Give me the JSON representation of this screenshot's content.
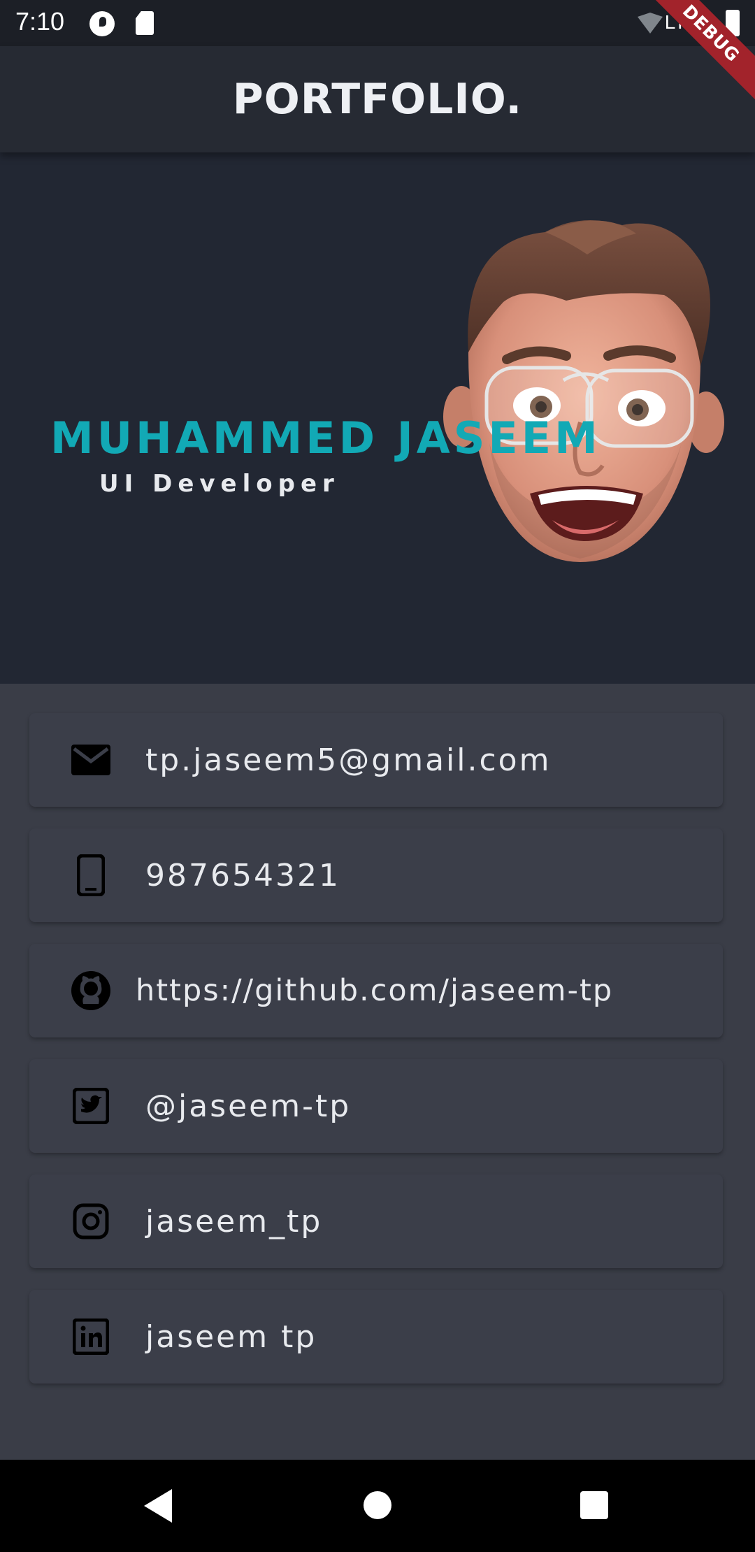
{
  "status_bar": {
    "time": "7:10",
    "network_label": "LTE",
    "debug_label": "DEBUG"
  },
  "app_bar": {
    "title": "PORTFOLIO."
  },
  "hero": {
    "name": "MUHAMMED JASEEM",
    "role": "UI Developer",
    "avatar": "memoji-avatar"
  },
  "contacts": [
    {
      "icon": "email-icon",
      "value": "tp.jaseem5@gmail.com"
    },
    {
      "icon": "phone-icon",
      "value": "987654321"
    },
    {
      "icon": "github-icon",
      "value": "https://github.com/jaseem-tp"
    },
    {
      "icon": "twitter-icon",
      "value": "@jaseem-tp"
    },
    {
      "icon": "instagram-icon",
      "value": "jaseem_tp"
    },
    {
      "icon": "linkedin-icon",
      "value": "jaseem tp"
    }
  ],
  "nav_bar": {
    "back": "back-icon",
    "home": "home-icon",
    "recents": "recents-icon"
  },
  "colors": {
    "accent": "#12a9b5",
    "app_bar": "#262a33",
    "hero_bg": "#222733",
    "body_bg": "#3a3d47",
    "card_bg": "#3b3e49"
  }
}
